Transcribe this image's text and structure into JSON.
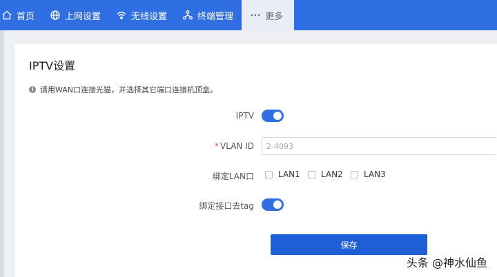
{
  "nav": {
    "items": [
      {
        "label": "首页",
        "icon": "home-icon"
      },
      {
        "label": "上网设置",
        "icon": "globe-icon"
      },
      {
        "label": "无线设置",
        "icon": "wifi-icon"
      },
      {
        "label": "终端管理",
        "icon": "network-icon"
      },
      {
        "label": "更多",
        "icon": "more-icon"
      }
    ],
    "active_index": 4,
    "accent_color": "#2f6fe3"
  },
  "page": {
    "title": "IPTV设置",
    "hint": "请用WAN口连接光猫，并选择其它端口连接机顶盒。"
  },
  "form": {
    "iptv": {
      "label": "IPTV",
      "enabled": true
    },
    "vlan": {
      "required_mark": "*",
      "label": "VLAN ID",
      "value": "",
      "placeholder": "2-4093"
    },
    "bind_lan": {
      "label": "绑定LAN口",
      "options": [
        {
          "label": "LAN1",
          "checked": false
        },
        {
          "label": "LAN2",
          "checked": false
        },
        {
          "label": "LAN3",
          "checked": false
        }
      ]
    },
    "untag": {
      "label": "绑定接口去tag",
      "enabled": true
    },
    "save_label": "保存"
  },
  "watermark": "头条 @神水仙鱼"
}
